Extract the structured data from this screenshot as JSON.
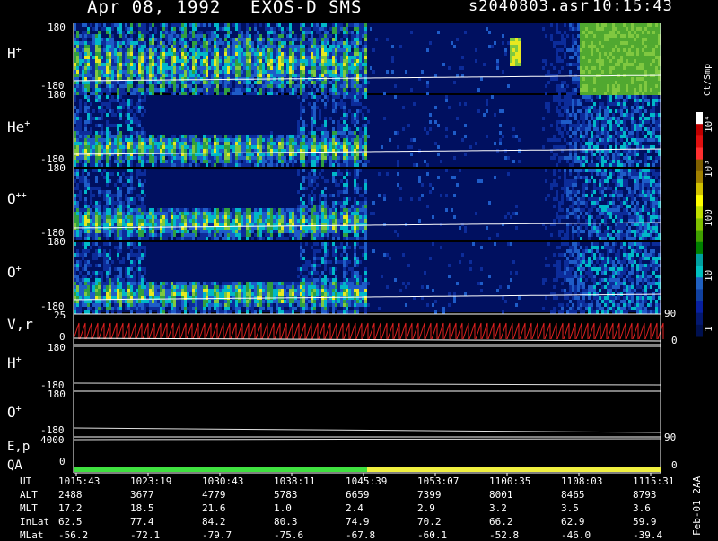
{
  "header": {
    "date": "Apr 08, 1992",
    "instrument": "EXOS-D SMS",
    "file": "s2040803.asr",
    "time": "10:15:43"
  },
  "panels": [
    {
      "label": "H",
      "sup": "+",
      "top": "180",
      "bottom": "-180"
    },
    {
      "label": "He",
      "sup": "+",
      "top": "180",
      "bottom": "-180"
    },
    {
      "label": "O",
      "sup": "++",
      "top": "180",
      "bottom": "-180"
    },
    {
      "label": "O",
      "sup": "+",
      "top": "180",
      "bottom": "-180"
    }
  ],
  "vr_panel": {
    "label": "V,r",
    "top": "25",
    "mid": "0",
    "right_top": "90",
    "right_bottom": "0"
  },
  "line_panels": [
    {
      "label": "H",
      "sup": "+",
      "top": "180",
      "bottom": "-180"
    },
    {
      "label": "O",
      "sup": "+",
      "top": "180",
      "bottom": "-180"
    }
  ],
  "ep_panel": {
    "label": "E,p",
    "left": "4000",
    "right": "90"
  },
  "qa_panel": {
    "label": "QA",
    "left": "0",
    "right": "0"
  },
  "colorbar": {
    "unit": "Ct/Smp",
    "ticks": [
      "10",
      "3",
      "100",
      "10",
      "10",
      "1"
    ],
    "labels": [
      "10⁴",
      "10³",
      "100",
      "10",
      "1"
    ],
    "colors": [
      "#ffffff",
      "#c00000",
      "#e01010",
      "#ff3030",
      "#806000",
      "#a08000",
      "#d0c000",
      "#ffff00",
      "#c0e000",
      "#80c000",
      "#40a000",
      "#008000",
      "#00a0a0",
      "#00c0c0",
      "#2060c0",
      "#1040a0",
      "#0820a0",
      "#041870",
      "#001050"
    ]
  },
  "side_tag": "Feb-01 2AA",
  "table": {
    "rows": [
      {
        "name": "UT",
        "values": [
          "1015:43",
          "1023:19",
          "1030:43",
          "1038:11",
          "1045:39",
          "1053:07",
          "1100:35",
          "1108:03",
          "1115:31"
        ]
      },
      {
        "name": "ALT",
        "values": [
          "2488",
          "3677",
          "4779",
          "5783",
          "6659",
          "7399",
          "8001",
          "8465",
          "8793"
        ]
      },
      {
        "name": "MLT",
        "values": [
          "17.2",
          "18.5",
          "21.6",
          "1.0",
          "2.4",
          "2.9",
          "3.2",
          "3.5",
          "3.6"
        ]
      },
      {
        "name": "InLat",
        "values": [
          "62.5",
          "77.4",
          "84.2",
          "80.3",
          "74.9",
          "70.2",
          "66.2",
          "62.9",
          "59.9"
        ]
      },
      {
        "name": "MLat",
        "values": [
          "-56.2",
          "-72.1",
          "-79.7",
          "-75.6",
          "-67.8",
          "-60.1",
          "-52.8",
          "-46.0",
          "-39.4"
        ]
      }
    ]
  },
  "chart_data": {
    "type": "heatmap",
    "title": "Apr 08, 1992    EXOS-D SMS",
    "x_label": "UT",
    "x_ticks": [
      "1015:43",
      "1023:19",
      "1030:43",
      "1038:11",
      "1045:39",
      "1053:07",
      "1100:35",
      "1108:03",
      "1115:31"
    ],
    "y_range": [
      -180,
      180
    ],
    "series": [
      {
        "name": "H+",
        "units": "Ct/Smp"
      },
      {
        "name": "He+",
        "units": "Ct/Smp"
      },
      {
        "name": "O++",
        "units": "Ct/Smp"
      },
      {
        "name": "O+",
        "units": "Ct/Smp"
      }
    ],
    "colorbar_range": [
      1,
      10000
    ],
    "colorbar_scale": "log",
    "qa_segments": [
      {
        "from": "1015:43",
        "to": "1045:39",
        "color": "#40e040"
      },
      {
        "from": "1045:39",
        "to": "1115:31",
        "color": "#f0f040"
      }
    ]
  }
}
